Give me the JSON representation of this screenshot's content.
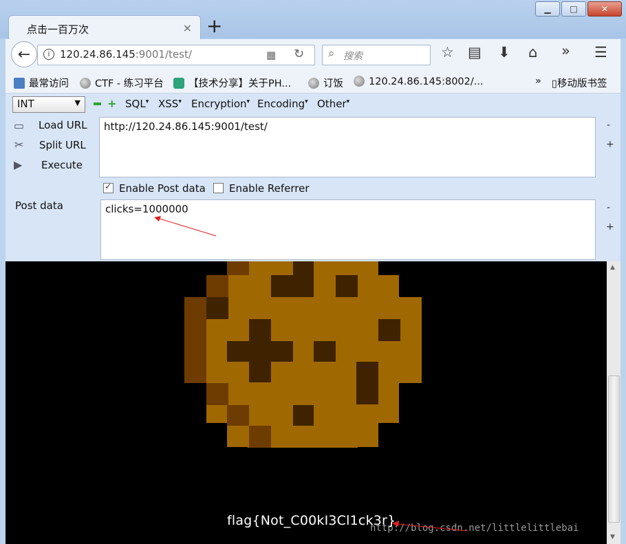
{
  "tab": {
    "title": "点击一百万次",
    "close": "×",
    "new": "+"
  },
  "window": {
    "minimize": "▁",
    "maximize": "□",
    "close": "✕"
  },
  "nav": {
    "url_host": "120.24.86.145",
    "url_rest": ":9001/test/",
    "search_placeholder": "搜索",
    "back": "←",
    "reload": "↻",
    "more": "»",
    "menu": "☰"
  },
  "bookmarks": {
    "items": [
      "最常访问",
      "CTF - 练习平台",
      "【技术分享】关于PH...",
      "订饭",
      "120.24.86.145:8002/..."
    ],
    "overflow": "»",
    "mobile": "移动版书签"
  },
  "hackbar": {
    "select_value": "INT",
    "menus": [
      "SQL",
      "XSS",
      "Encryption",
      "Encoding",
      "Other"
    ],
    "load_url": "Load URL",
    "split_url": "Split URL",
    "execute": "Execute",
    "url_value": "http://120.24.86.145:9001/test/",
    "enable_post": "Enable Post data",
    "enable_referrer": "Enable Referrer",
    "post_label": "Post data",
    "post_value": "clicks=1000000",
    "minus": "-",
    "plus": "+"
  },
  "content": {
    "flag": "flag{Not_C00kI3Cl1ck3r}",
    "watermark": "http://blog.csdn.net/littlelittlebai"
  },
  "colors": {
    "cookie_light": "#a06800",
    "cookie_dark": "#3f2300",
    "cookie_edge": "#6e3c00",
    "annotation": "#e02020"
  }
}
